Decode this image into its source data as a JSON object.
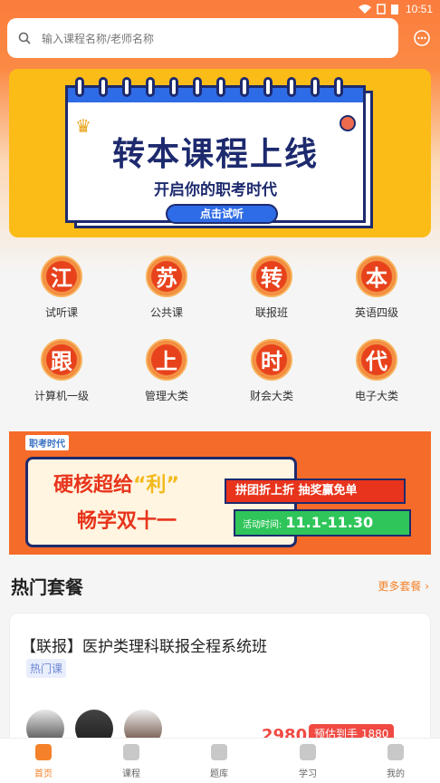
{
  "status": {
    "time": "10:51"
  },
  "search": {
    "placeholder": "输入课程名称/老师名称"
  },
  "banner": {
    "title": "转本课程上线",
    "subtitle": "开启你的职考时代",
    "button": "点击试听"
  },
  "grid": [
    {
      "char": "江",
      "label": "试听课"
    },
    {
      "char": "苏",
      "label": "公共课"
    },
    {
      "char": "转",
      "label": "联报班"
    },
    {
      "char": "本",
      "label": "英语四级"
    },
    {
      "char": "跟",
      "label": "计算机一级"
    },
    {
      "char": "上",
      "label": "管理大类"
    },
    {
      "char": "时",
      "label": "财会大类"
    },
    {
      "char": "代",
      "label": "电子大类"
    }
  ],
  "promo": {
    "logo": "职考时代",
    "title_a": "硬核超给",
    "title_quote": "“利”",
    "title_b": "畅学双十一",
    "pill1": "拼团折上折 抽奖赢免单",
    "pill2_label": "活动时间:",
    "pill2_value": "11.1-11.30"
  },
  "hot": {
    "title": "热门套餐",
    "more": "更多套餐"
  },
  "course": {
    "title": "【联报】医护类理科联报全程系统班",
    "tag": "热门课",
    "price": "2980",
    "presale": "预估到手 1880"
  },
  "tabs": [
    {
      "label": "首页",
      "icon": "home-icon"
    },
    {
      "label": "课程",
      "icon": "course-icon"
    },
    {
      "label": "题库",
      "icon": "question-bank-icon"
    },
    {
      "label": "学习",
      "icon": "study-icon"
    },
    {
      "label": "我的",
      "icon": "profile-icon"
    }
  ],
  "colors": {
    "accent": "#f5822a",
    "brand": "#fb7c3c",
    "banner": "#fcbc17"
  }
}
